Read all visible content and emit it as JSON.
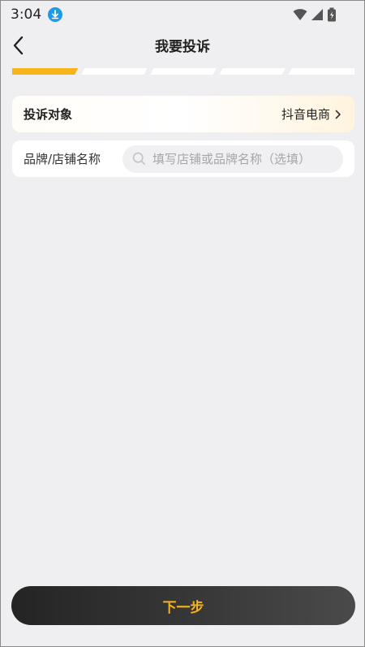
{
  "status_bar": {
    "time": "3:04",
    "icons": [
      "download-icon",
      "wifi-icon",
      "signal-icon",
      "battery-icon"
    ]
  },
  "header": {
    "title": "我要投诉",
    "back_icon": "back-arrow-icon"
  },
  "progress": {
    "total_steps": 5,
    "current_step": 1,
    "accent_color": "#f7b31a"
  },
  "complaint_target": {
    "label": "投诉对象",
    "value": "抖音电商"
  },
  "brand": {
    "label": "品牌/店铺名称",
    "value": "",
    "placeholder": "填写店铺或品牌名称（选填）"
  },
  "footer": {
    "next_label": "下一步"
  },
  "colors": {
    "background": "#efeff1",
    "accent": "#f7b31a",
    "button_dark": "#2a2a2a"
  }
}
